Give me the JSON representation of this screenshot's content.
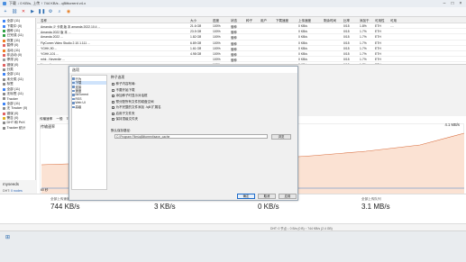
{
  "window": {
    "title": "下载 ↓ 0 KB/s, 上传 ↑ 744 KB/s - qBittorrent v4.x"
  },
  "toolbar": {
    "icons": [
      "add-icon",
      "link-icon",
      "delete-icon",
      "play-icon",
      "pause-icon",
      "settings-icon",
      "search-icon",
      "rss-icon"
    ]
  },
  "sidebar": {
    "items": [
      {
        "label": "全部 (11)",
        "color": "#3b82f6"
      },
      {
        "label": "下载中 (0)",
        "color": "#3b82f6"
      },
      {
        "label": "做种 (11)",
        "color": "#2ea043"
      },
      {
        "label": "已完成 (11)",
        "color": "#2ea043"
      },
      {
        "label": "恢复 (11)",
        "color": "#ef7d22"
      },
      {
        "label": "暂停 (0)",
        "color": "#e06060"
      },
      {
        "label": "活动 (11)",
        "color": "#ef7d22"
      },
      {
        "label": "非活动 (0)",
        "color": "#e06060"
      },
      {
        "label": "停滞 (0)",
        "color": "#999999"
      },
      {
        "label": "错误 (0)",
        "color": "#e06060"
      },
      {
        "label": "分类",
        "color": "#888888"
      },
      {
        "label": "全部 (11)",
        "color": "#3b82f6"
      },
      {
        "label": "未分类 (11)",
        "color": "#888888"
      },
      {
        "label": "标签",
        "color": "#888888"
      },
      {
        "label": "全部 (11)",
        "color": "#3b82f6"
      },
      {
        "label": "无标签 (11)",
        "color": "#888888"
      },
      {
        "label": "Tracker",
        "color": "#888888"
      },
      {
        "label": "全部 (11)",
        "color": "#3b82f6"
      },
      {
        "label": "无 Tracker (0)",
        "color": "#888888"
      },
      {
        "label": "错误 (0)",
        "color": "#e06060"
      },
      {
        "label": "警告 (0)",
        "color": "#e0b020"
      },
      {
        "label": "DHT 和 PeX",
        "color": "#888888"
      },
      {
        "label": "Tracker 统计",
        "color": "#888888"
      }
    ]
  },
  "list": {
    "headers": [
      "名称",
      "大小",
      "进度",
      "状态",
      "种子",
      "用户",
      "下载速度",
      "上传速度",
      "剩余时间",
      "比率",
      "添加于",
      "可用性",
      "可用"
    ],
    "rows": [
      [
        "Amanda 少 卡顿 版 本 amanda 2022.10.4 ...",
        "21.6 GB",
        "100%",
        "做种",
        "",
        "",
        "",
        "0 KB/s",
        "",
        "0/15",
        "1.8%",
        "ETH",
        "...."
      ],
      [
        "Amanda 2022 版 本 ...",
        "23.5 GB",
        "100%",
        "做种",
        "",
        "",
        "",
        "0 KB/s",
        "",
        "0/15",
        "1.7%",
        "ETH",
        ""
      ],
      [
        "Amanda 2022 ...",
        "1.82 GB",
        "100%",
        "做种",
        "",
        "",
        "",
        "0 KB/s",
        "",
        "0/15",
        "1.7%",
        "ETH",
        ""
      ],
      [
        "FlyComm Video Studio 2.10.1.111 ...",
        "6.89 GB",
        "100%",
        "做种",
        "",
        "",
        "",
        "0 KB/s",
        "",
        "0/15",
        "1.7%",
        "ETH",
        ""
      ],
      [
        "YGHK-90 ...",
        "1.61 GB",
        "100%",
        "做种",
        "",
        "",
        "",
        "0 KB/s",
        "",
        "0/15",
        "1.7%",
        "ETH",
        ""
      ],
      [
        "YGHK-101 ...",
        "4.98 GB",
        "100%",
        "做种",
        "",
        "",
        "",
        "0 KB/s",
        "",
        "0/15",
        "1.7%",
        "ETH",
        ""
      ],
      [
        "mhk - Neverdie ...",
        "",
        "100%",
        "做种",
        "",
        "",
        "",
        "0 KB/s",
        "",
        "0/15",
        "1.7%",
        "ETH",
        ""
      ],
      [
        "Neverdie ...",
        "",
        "100%",
        "做种",
        "",
        "",
        "",
        "0 KB/s",
        "",
        "0/15",
        "1.7%",
        "ETH",
        ""
      ]
    ]
  },
  "detail": {
    "tabs": [
      "传输速率",
      "一般",
      "Tracker"
    ],
    "graph_title": "传输速率",
    "rate": "4.1 MB/s",
    "x_label": "60 秒"
  },
  "stats": {
    "upload": {
      "label": "全部上传速度",
      "value": "744 KB/s"
    },
    "download": {
      "label": "全部下载速度",
      "value": "3 KB/s"
    },
    "dl_queue": {
      "label": "全部下载队列",
      "value": "0 KB/s"
    },
    "ul_queue": {
      "label": "全部上传队列",
      "value": "3.1 MB/s"
    }
  },
  "left_info": {
    "name": "myseeds",
    "rows": [
      {
        "k": "DHT:",
        "v": "0 nodes"
      },
      {
        "k": "速度:",
        "v": "744 KB/s"
      },
      {
        "k": "上传:",
        "v": "3 KB/s"
      },
      {
        "k": "下载:",
        "v": "0 B/s"
      }
    ]
  },
  "statusbar": {
    "text": "DHT: 0 节点   ↓ 0 B/s (0 B)   ↑ 744 KB/s (2.4 GB)"
  },
  "dialog": {
    "title": "选项",
    "tree": [
      "行为",
      "下载",
      "连接",
      "速度",
      "BitTorrent",
      "RSS",
      "Web UI",
      "高级"
    ],
    "section": "种子选项",
    "options": [
      {
        "label": "种子内容布局:",
        "checked": false
      },
      {
        "label": "不要开始下载",
        "checked": false
      },
      {
        "label": "添加种子时显示对话框",
        "checked": true
      },
      {
        "label": "预分配所有文件的磁盘空间",
        "checked": false
      },
      {
        "label": "为不完整的文件添加 .!qB 扩展名",
        "checked": true
      },
      {
        "label": "启用子文件夹",
        "checked": true
      },
      {
        "label": "保持顶级文件夹",
        "checked": false
      }
    ],
    "save_label": "默认保存路径:",
    "save_path": "C:\\Program Files\\qBittorrent\\save_cache",
    "browse": "浏览",
    "ok": "确定",
    "cancel": "取消",
    "apply": "应用"
  }
}
